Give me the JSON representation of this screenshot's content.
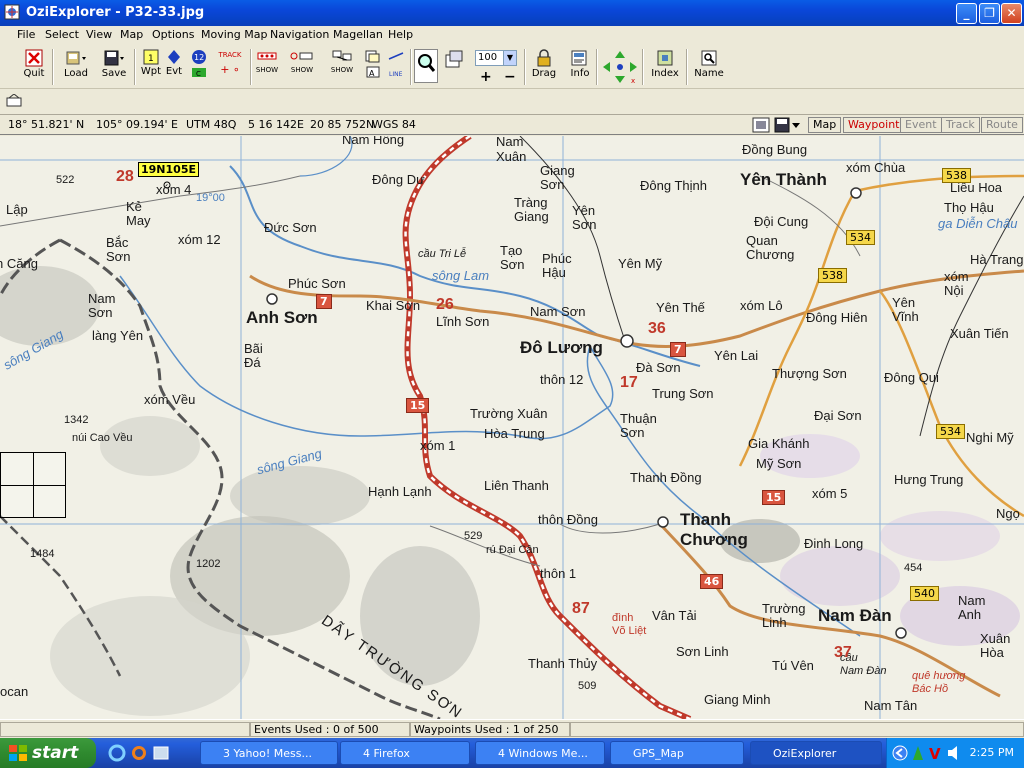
{
  "window": {
    "title": "OziExplorer - P32-33.jpg"
  },
  "menu": [
    "File",
    "Select",
    "View",
    "Map",
    "Options",
    "Moving Map",
    "Navigation",
    "Magellan",
    "Help"
  ],
  "toolbar": {
    "quit": "Quit",
    "load": "Load",
    "save": "Save",
    "wpt": "Wpt",
    "evt": "Evt",
    "track": "TRACK",
    "show1": "SHOW",
    "show2": "SHOW",
    "show3": "SHOW",
    "line": "LINE",
    "zoom_value": "100",
    "drag": "Drag",
    "info": "Info",
    "index": "Index",
    "name": "Name"
  },
  "coords": {
    "lat": "18° 51.821' N",
    "lon": "105° 09.194' E",
    "utm_zone": "UTM  48Q",
    "easting": "5 16 142E",
    "northing": "20 85 752N",
    "datum": "WGS 84"
  },
  "modes": [
    "Map",
    "Waypoint",
    "Event",
    "Track",
    "Route"
  ],
  "map": {
    "waypoint_flag": "19N105E",
    "labels": {
      "nam_hong": "Nam Hông",
      "nam_xuan": "Nam\nXuân",
      "dong_du": "Đông Dư",
      "giang_son": "Giang\nSơn",
      "dong_thinh": "Đông Thịnh",
      "yen_thanh": "Yên Thành",
      "dong_bung": "Đồng Bung",
      "xom_chua": "xóm Chùa",
      "lieu_hoa": "Liêu Hoa",
      "tho_hau": "Thọ Hậu",
      "dien_chau": "ga Diễn Châu",
      "ha_trang": "Hà Trang",
      "xom_noi": "xóm\nNội",
      "lap": "Lập",
      "ke_may": "Kẻ\nMay",
      "xom4": "xóm 4",
      "xom12": "xóm 12",
      "bac_son": "Bắc\nSơn",
      "can_g": "n Căng",
      "duc_son": "Đức Sơn",
      "trang_giang": "Tràng\nGiang",
      "yen_son": "Yên\nSơn",
      "tao_son": "Tạo\nSơn",
      "phuc_hau": "Phúc\nHậu",
      "yen_my": "Yên Mỹ",
      "doi_cung": "Đội Cung",
      "quan_chuong": "Quan\nChương",
      "cau_tri_le": "cầu Tri Lễ",
      "song_lam": "sông Lam",
      "phuc_son": "Phúc Sơn",
      "anh_son": "Anh Sơn",
      "khai_son": "Khai Sơn",
      "linh_son": "Lĩnh Sơn",
      "nam_son_1": "Nam Sơn",
      "do_luong": "Đô Lương",
      "yen_the": "Yên Thế",
      "xom_lo": "xóm Lô",
      "dong_hien": "Đông Hiên",
      "yen_vinh": "Yên\nVĩnh",
      "xuan_tien": "Xuân Tiến",
      "nam_son_2": "Nam\nSơn",
      "lang_yen": "làng Yên",
      "song_giang_1": "sông Giang",
      "bai_da": "Bãi\nĐá",
      "thon12": "thôn 12",
      "da_son": "Đà Sơn",
      "yen_lai": "Yên Lai",
      "thuong_son": "Thượng Sơn",
      "dong_qui": "Đông Qui",
      "xom_veu": "xóm Vều",
      "truong_xuan": "Trường Xuân",
      "hoa_trung": "Hòa Trung",
      "trung_son": "Trung Sơn",
      "thuan_son": "Thuận\nSơn",
      "dai_son": "Đại Sơn",
      "nghi_my": "Nghi Mỹ",
      "nui_cao_veu": "núi Cao Vều",
      "song_giang_2": "sông Giang",
      "xom1": "xóm 1",
      "gia_khanh": "Gia Khánh",
      "my_son": "Mỹ Sơn",
      "hanh_lanh": "Hạnh Lạnh",
      "lien_thanh": "Liên Thanh",
      "thanh_dong": "Thanh Đồng",
      "xom5": "xóm 5",
      "hung_trung": "Hưng Trung",
      "ngo": "Ngọ",
      "thon_dong": "thôn Đồng",
      "thanh_chuong": "Thanh\nChương",
      "dinh_long": "Đinh Long",
      "dai_can": "rú Đại Cân",
      "thon1": "thôn 1",
      "day_truong_son": "DÃY TRƯỜNG SƠN",
      "van_tai": "Vân Tải",
      "dinh_vo_liet": "đình\nVõ Liệt",
      "truong_linh": "Trường\nLinh",
      "nam_dan": "Nam Đàn",
      "nam_anh": "Nam\nAnh",
      "xuan_hoa": "Xuân\nHòa",
      "son_linh": "Sơn Linh",
      "tu_ven": "Tú Vên",
      "cau_nam_dan": "cầu\nNam Đàn",
      "que_huong": "quê hương\nBác Hồ",
      "thanh_thuy": "Thanh Thủy",
      "giang_minh": "Giang Minh",
      "nam_tan": "Nam Tân",
      "ocan": "ocan"
    },
    "numbers": {
      "n28": "28",
      "n26": "26",
      "n36": "36",
      "n17": "17",
      "n87": "87",
      "n37": "37",
      "e522": "522",
      "e1342": "1342",
      "e1484": "1484",
      "e1202": "1202",
      "e529": "529",
      "e509": "509",
      "e454": "454",
      "e19": "19°00"
    },
    "shields": {
      "r7a": "7",
      "r7b": "7",
      "r15a": "15",
      "r15b": "15",
      "r46": "46",
      "y538a": "538",
      "y538b": "538",
      "y534a": "534",
      "y534b": "534",
      "y540": "540"
    }
  },
  "status": {
    "events": "Events Used : 0 of 500",
    "waypoints": "Waypoints Used : 1 of 250"
  },
  "taskbar": {
    "start": "start",
    "tasks": [
      "3 Yahoo! Mess...",
      "4 Firefox",
      "4 Windows Me...",
      "GPS_Map",
      "OziExplorer"
    ],
    "clock": "2:25 PM"
  }
}
